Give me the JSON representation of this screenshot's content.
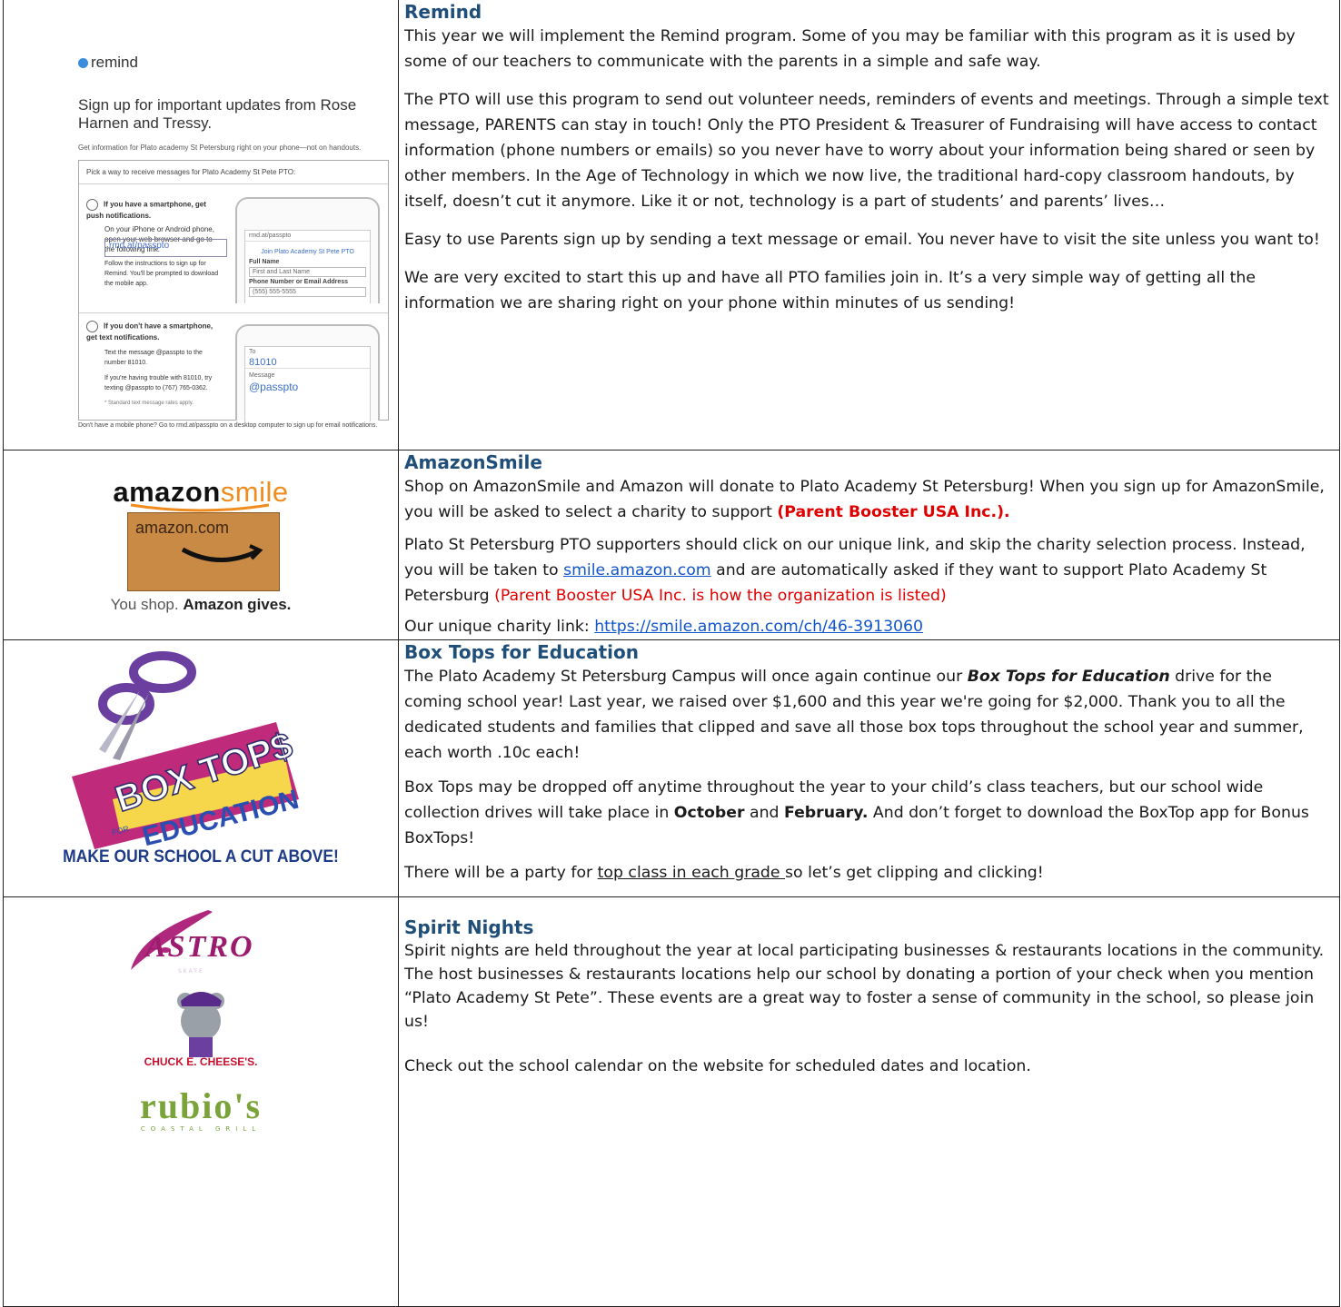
{
  "remind": {
    "heading": "Remind",
    "p1": "This year we will implement the Remind program. Some of you may be familiar with this program as it is used by some of our teachers to communicate with the parents in a simple and safe way.",
    "p2": "The PTO will use this program to send out volunteer needs, reminders of events and meetings. Through a simple text message, PARENTS can stay in touch! Only the PTO President & Treasurer of Fundraising will have access to contact information (phone numbers or emails) so you never have to worry about your information being shared or seen by other members.  In the Age of Technology in which we now live, the traditional hard-copy classroom handouts, by itself, doesn’t cut it anymore. Like it or not, technology is a part of students’ and parents’ lives…",
    "p3": "Easy to use Parents sign up by sending a text message or email. You never have to visit the site unless you want to!",
    "p4": "We are very excited to start this up and have all PTO families join in. It’s a very simple way of getting all the information we are sharing right on your phone within minutes of us sending!",
    "flyer": {
      "logo": "remind",
      "headline": "Sign up for important updates from Rose Harnen and Tressy.",
      "subline": "Get information for Plato academy St Petersburg  right on your phone—not on handouts.",
      "box_title": "Pick a way to receive messages for Plato Academy St Pete PTO:",
      "step_a_title": "If you have a smartphone, get push notifications.",
      "step_a_body": "On your iPhone or Android phone, open your web browser and go to the following link:",
      "step_a_url": "rmd.at/passpto",
      "step_a_after": "Follow the instructions to sign up for Remind. You'll be prompted to download the mobile app.",
      "phone1_url": "rmd.at/passpto",
      "phone1_join": "Join Plato Academy St Pete PTO",
      "phone1_fullname": "Full Name",
      "phone1_fullname_ph": "First and Last Name",
      "phone1_contact": "Phone Number or Email Address",
      "phone1_contact_ph": "(555) 555-5555",
      "step_b_title": "If you don't have a smartphone, get text notifications.",
      "step_b_body": "Text the message @passpto to the number 81010.",
      "step_b_help": "If you're having trouble with 81010, try texting @passpto to (767) 765-0362.",
      "step_b_rates": "* Standard text message rates apply.",
      "phone2_to": "To",
      "phone2_number": "81010",
      "phone2_msg": "Message",
      "phone2_code": "@passpto",
      "footer": "Don't have a mobile phone? Go to rmd.at/passpto on a desktop computer to sign up for email notifications."
    }
  },
  "amazon": {
    "heading": "AmazonSmile",
    "p1_a": "Shop on AmazonSmile and Amazon will donate to Plato Academy St Petersburg! When you sign up for AmazonSmile, you will be asked to select a charity to support ",
    "p1_b": "(Parent Booster USA Inc.).",
    "p2_a": "Plato St Petersburg PTO supporters should click on our unique link, and skip the charity selection process. Instead, you will be taken to ",
    "p2_link": "smile.amazon.com",
    "p2_b": " and are automatically asked if they want to support Plato Academy St Petersburg ",
    "p2_red": "(Parent Booster USA Inc. is how the organization is listed)",
    "p3_a": "Our unique charity link: ",
    "p3_link": "https://smile.amazon.com/ch/46-3913060",
    "logo_amazon": "amazon",
    "logo_smile": "smile",
    "box_label": "amazon.com",
    "tag_a": "You shop. ",
    "tag_b": "Amazon gives."
  },
  "boxtops": {
    "heading": "Box Tops for Education",
    "p1_a": "The Plato Academy St Petersburg Campus will once again continue our ",
    "p1_em": "Box Tops for Education",
    "p1_b": " drive for the coming school year! Last year, we raised over $1,600 and this year we're going for $2,000.  Thank you to all the dedicated students and families that clipped and save all those box tops throughout the school year and summer, each worth .10c each!",
    "p2_a": "Box Tops may be dropped off anytime throughout the year to your child’s class teachers, but our school wide collection drives will take place in ",
    "p2_oct": "October",
    "p2_and": " and ",
    "p2_feb": "February.",
    "p2_b": " And don’t forget to download the BoxTop app for Bonus BoxTops!",
    "p3_a": "There will be a party for ",
    "p3_ul": "top class in each grade ",
    "p3_b": "so let’s get clipping and clicking!",
    "logo_box": "BOX TOP$",
    "logo_for": "FOR",
    "logo_edu": "EDUCATION",
    "logo_bottom": "MAKE OUR SCHOOL A CUT ABOVE!"
  },
  "spirit": {
    "heading": "Spirit Nights",
    "p1": "Spirit nights are held throughout the year at local participating businesses & restaurants locations in the community. The host businesses & restaurants locations help our school by donating a portion of your check when you mention “Plato Academy St Pete”. These events are a great way to foster a sense of community in the school, so please join us!",
    "p2": "Check out the school calendar on the website for scheduled dates and location.",
    "logo_astro": "ASTRO",
    "logo_astro_sub": "SKATE",
    "logo_chuck": "CHUCK E. CHEESE'S.",
    "logo_rubios": "rubio's",
    "logo_coastal": "COASTAL GRILL"
  }
}
